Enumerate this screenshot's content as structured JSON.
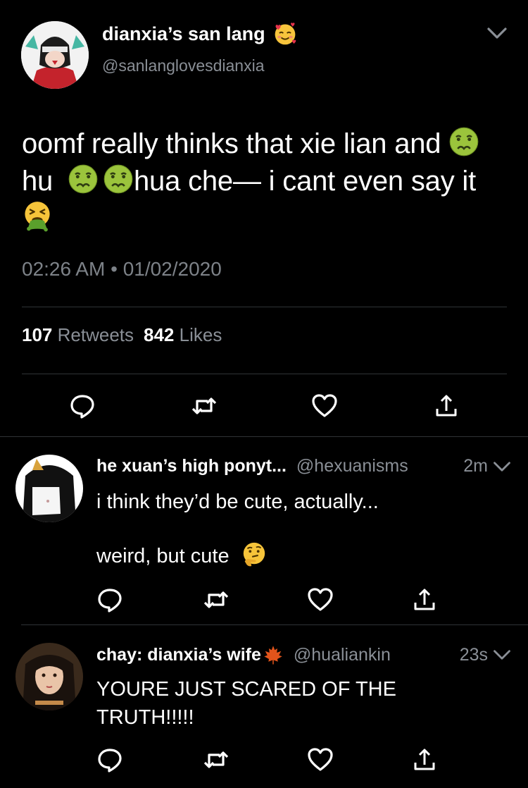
{
  "main_tweet": {
    "display_name": "dianxia’s san lang",
    "name_emoji": "smiling-face-with-hearts-icon",
    "handle": "@sanlanglovesdianxia",
    "text_line1": "oomf really thinks that xie lian and",
    "text_line2_a": "hu",
    "text_line2_b": "hua che— i cant even say it",
    "time": "02:26 AM",
    "separator": "•",
    "date": "01/02/2020",
    "retweets_count": "107",
    "retweets_label": "Retweets",
    "likes_count": "842",
    "likes_label": "Likes"
  },
  "replies": [
    {
      "display_name": "he xuan’s high ponyt...",
      "handle": "@hexuanisms",
      "time": "2m",
      "text_line1": "i think they’d be cute, actually...",
      "text_line2": "weird, but cute",
      "text_emoji": "thinking-face-icon"
    },
    {
      "display_name": "chay: dianxia’s wife",
      "name_emoji": "maple-leaf-icon",
      "handle": "@hualiankin",
      "time": "23s",
      "text_line1": "YOURE JUST SCARED OF THE",
      "text_line2": "TRUTH!!!!!"
    }
  ],
  "colors": {
    "background": "#000000",
    "text": "#ffffff",
    "secondary_text": "#8a8f96",
    "divider": "#2f3336",
    "action_icon": "#ffffff"
  }
}
